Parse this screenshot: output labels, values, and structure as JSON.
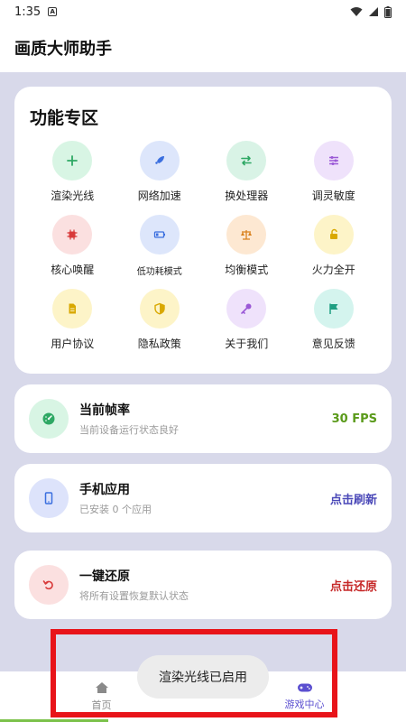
{
  "status_bar": {
    "time": "1:35",
    "notif_glyph": "A"
  },
  "app_bar": {
    "title": "画质大师助手"
  },
  "features": {
    "title": "功能专区",
    "items": [
      {
        "label": "渲染光线",
        "icon": "plus-icon",
        "bg": "#d8f5e4",
        "fg": "#2ea864"
      },
      {
        "label": "网络加速",
        "icon": "rocket-icon",
        "bg": "#dde6fb",
        "fg": "#3b6fdf"
      },
      {
        "label": "换处理器",
        "icon": "swap-icon",
        "bg": "#d9f3e6",
        "fg": "#2ea864"
      },
      {
        "label": "调灵敏度",
        "icon": "sliders-icon",
        "bg": "#efe2fb",
        "fg": "#9b59d6"
      },
      {
        "label": "核心唤醒",
        "icon": "chip-icon",
        "bg": "#fbe0e0",
        "fg": "#d83a3a"
      },
      {
        "label": "低功耗模式",
        "icon": "battery-icon",
        "bg": "#dde6fb",
        "fg": "#3b6fdf"
      },
      {
        "label": "均衡模式",
        "icon": "scale-icon",
        "bg": "#fde8d2",
        "fg": "#d9811e"
      },
      {
        "label": "火力全开",
        "icon": "unlock-icon",
        "bg": "#fdf4c8",
        "fg": "#d9a800"
      },
      {
        "label": "用户协议",
        "icon": "document-icon",
        "bg": "#fdf4c8",
        "fg": "#d9a800"
      },
      {
        "label": "隐私政策",
        "icon": "shield-icon",
        "bg": "#fdf4c8",
        "fg": "#d9a800"
      },
      {
        "label": "关于我们",
        "icon": "key-icon",
        "bg": "#efe2fb",
        "fg": "#9b59d6"
      },
      {
        "label": "意见反馈",
        "icon": "flag-icon",
        "bg": "#d4f4ee",
        "fg": "#1f9e82"
      }
    ]
  },
  "fps_card": {
    "title": "当前帧率",
    "subtitle": "当前设备运行状态良好",
    "value": "30 FPS",
    "value_color": "#5a9a1a",
    "icon": "gauge-icon"
  },
  "apps_card": {
    "title": "手机应用",
    "subtitle": "已安装 0 个应用",
    "action": "点击刷新",
    "action_color": "#4a48b8",
    "icon": "phone-icon"
  },
  "restore_card": {
    "title": "一键还原",
    "subtitle": "将所有设置恢复默认状态",
    "action": "点击还原",
    "action_color": "#c62828",
    "icon": "undo-icon"
  },
  "bottom_nav": {
    "home": {
      "label": "首页",
      "color": "#8a8a8a",
      "icon": "home-icon"
    },
    "games": {
      "label": "游戏中心",
      "color": "#5b4fd0",
      "icon": "gamepad-icon"
    }
  },
  "toast": {
    "text": "渲染光线已启用"
  }
}
